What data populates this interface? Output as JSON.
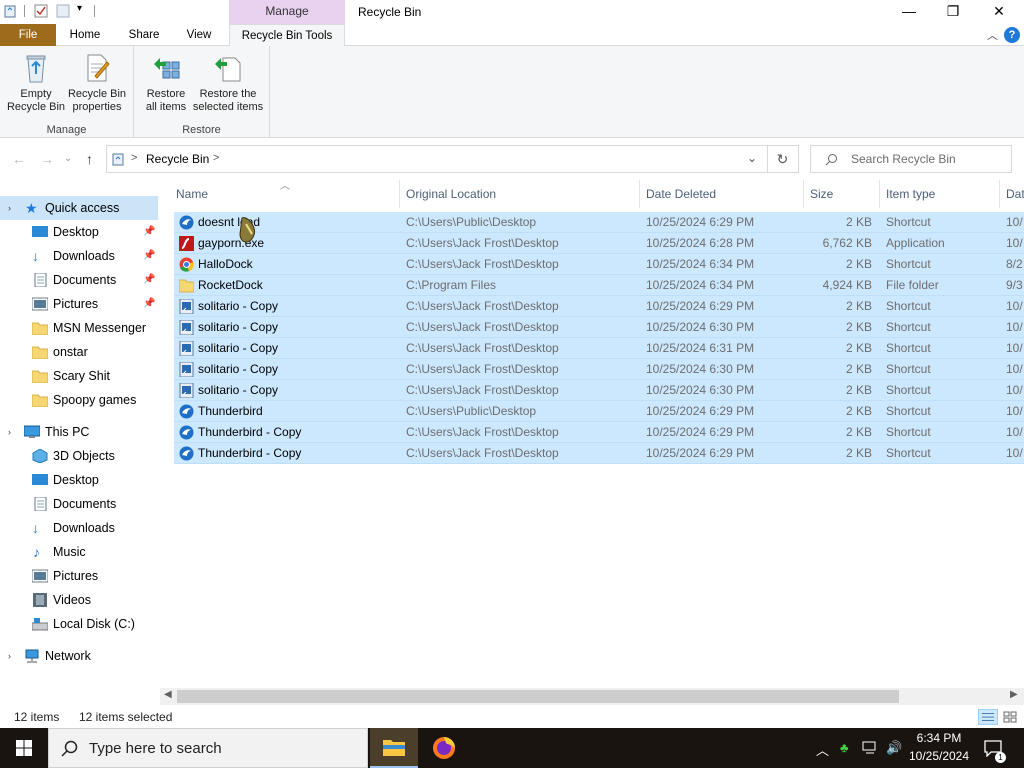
{
  "titlebar": {
    "contextual_group": "Manage",
    "title": "Recycle Bin",
    "minimize": "—",
    "maximize": "❐",
    "close": "✕"
  },
  "ribbon_tabs": {
    "file": "File",
    "home": "Home",
    "share": "Share",
    "view": "View",
    "recycle_bin_tools": "Recycle Bin Tools",
    "help": "?"
  },
  "ribbon": {
    "manage_group": {
      "label": "Manage",
      "empty_line1": "Empty",
      "empty_line2": "Recycle Bin",
      "props_line1": "Recycle Bin",
      "props_line2": "properties"
    },
    "restore_group": {
      "label": "Restore",
      "restore_all_line1": "Restore",
      "restore_all_line2": "all items",
      "restore_sel_line1": "Restore the",
      "restore_sel_line2": "selected items"
    }
  },
  "address": {
    "crumb_sep": ">",
    "location": "Recycle Bin",
    "search_placeholder": "Search Recycle Bin"
  },
  "nav": {
    "quick_access": "Quick access",
    "qa_items": [
      "Desktop",
      "Downloads",
      "Documents",
      "Pictures",
      "MSN Messenger",
      "onstar",
      "Scary Shit",
      "Spoopy games"
    ],
    "this_pc": "This PC",
    "pc_items": [
      "3D Objects",
      "Desktop",
      "Documents",
      "Downloads",
      "Music",
      "Pictures",
      "Videos",
      "Local Disk (C:)"
    ],
    "network": "Network"
  },
  "columns": {
    "name": "Name",
    "original_location": "Original Location",
    "date_deleted": "Date Deleted",
    "size": "Size",
    "item_type": "Item type",
    "date_modified": "Dat"
  },
  "files": [
    {
      "name": "doesnt load",
      "location": "C:\\Users\\Public\\Desktop",
      "date": "10/25/2024 6:29 PM",
      "size": "2 KB",
      "type": "Shortcut",
      "modified": "10/",
      "icon": "thunderbird-icon"
    },
    {
      "name": "gayporn.exe",
      "location": "C:\\Users\\Jack Frost\\Desktop",
      "date": "10/25/2024 6:28 PM",
      "size": "6,762 KB",
      "type": "Application",
      "modified": "10/",
      "icon": "flash-icon"
    },
    {
      "name": "HalloDock",
      "location": "C:\\Users\\Jack Frost\\Desktop",
      "date": "10/25/2024 6:34 PM",
      "size": "2 KB",
      "type": "Shortcut",
      "modified": "8/2",
      "icon": "chrome-icon"
    },
    {
      "name": "RocketDock",
      "location": "C:\\Program Files",
      "date": "10/25/2024 6:34 PM",
      "size": "4,924 KB",
      "type": "File folder",
      "modified": "9/3",
      "icon": "folder-icon"
    },
    {
      "name": "solitario - Copy",
      "location": "C:\\Users\\Jack Frost\\Desktop",
      "date": "10/25/2024 6:29 PM",
      "size": "2 KB",
      "type": "Shortcut",
      "modified": "10/",
      "icon": "shortcut-icon"
    },
    {
      "name": "solitario - Copy",
      "location": "C:\\Users\\Jack Frost\\Desktop",
      "date": "10/25/2024 6:30 PM",
      "size": "2 KB",
      "type": "Shortcut",
      "modified": "10/",
      "icon": "shortcut-icon"
    },
    {
      "name": "solitario - Copy",
      "location": "C:\\Users\\Jack Frost\\Desktop",
      "date": "10/25/2024 6:31 PM",
      "size": "2 KB",
      "type": "Shortcut",
      "modified": "10/",
      "icon": "shortcut-icon"
    },
    {
      "name": "solitario - Copy",
      "location": "C:\\Users\\Jack Frost\\Desktop",
      "date": "10/25/2024 6:30 PM",
      "size": "2 KB",
      "type": "Shortcut",
      "modified": "10/",
      "icon": "shortcut-icon"
    },
    {
      "name": "solitario - Copy",
      "location": "C:\\Users\\Jack Frost\\Desktop",
      "date": "10/25/2024 6:30 PM",
      "size": "2 KB",
      "type": "Shortcut",
      "modified": "10/",
      "icon": "shortcut-icon"
    },
    {
      "name": "Thunderbird",
      "location": "C:\\Users\\Public\\Desktop",
      "date": "10/25/2024 6:29 PM",
      "size": "2 KB",
      "type": "Shortcut",
      "modified": "10/",
      "icon": "thunderbird-icon"
    },
    {
      "name": "Thunderbird - Copy",
      "location": "C:\\Users\\Jack Frost\\Desktop",
      "date": "10/25/2024 6:29 PM",
      "size": "2 KB",
      "type": "Shortcut",
      "modified": "10/",
      "icon": "thunderbird-icon"
    },
    {
      "name": "Thunderbird - Copy",
      "location": "C:\\Users\\Jack Frost\\Desktop",
      "date": "10/25/2024 6:29 PM",
      "size": "2 KB",
      "type": "Shortcut",
      "modified": "10/",
      "icon": "thunderbird-icon"
    }
  ],
  "status": {
    "count": "12 items",
    "selected": "12 items selected"
  },
  "taskbar": {
    "search_placeholder": "Type here to search",
    "time": "6:34 PM",
    "date": "10/25/2024",
    "notification_count": "1"
  },
  "colors": {
    "selection": "#cce8ff",
    "file_tab": "#9c6c1c",
    "contextual": "#e8d2f0",
    "accent": "#1e79d8"
  }
}
